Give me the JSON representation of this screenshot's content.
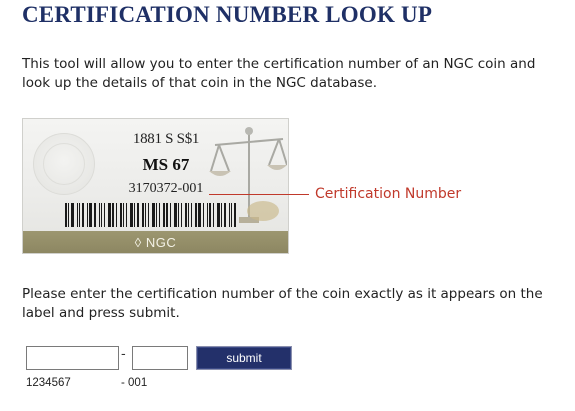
{
  "page": {
    "title": "CERTIFICATION NUMBER LOOK UP",
    "intro": "This tool will allow you to enter the certification number of an NGC coin and look up the details of that coin in the NGC database.",
    "instructions": "Please enter the certification number of the coin exactly as it appears on the label and press submit."
  },
  "label_example": {
    "coin_description": "1881 S S$1",
    "grade": "MS 67",
    "certification_number": "3170372-001",
    "brand": "NGC",
    "callout": "Certification Number",
    "icons": [
      "seal-emblem-icon",
      "scales-of-justice-icon",
      "barcode-icon",
      "ngc-logo-icon"
    ]
  },
  "form": {
    "cert_main_value": "",
    "cert_suffix_value": "",
    "separator": "-",
    "submit_label": "submit",
    "hint_main": "1234567",
    "hint_suffix": "- 001"
  },
  "colors": {
    "title": "#1f3066",
    "callout": "#c0392b",
    "submit_bg": "#23306a",
    "label_band": "#8d8762"
  }
}
